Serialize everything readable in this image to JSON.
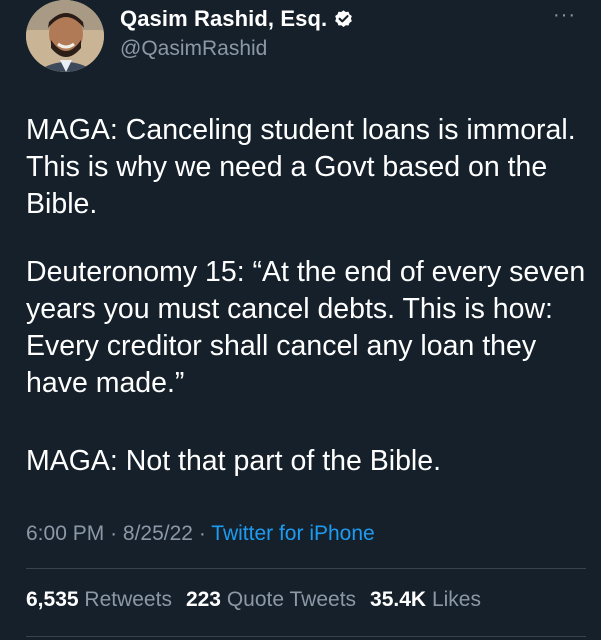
{
  "author": {
    "display_name": "Qasim Rashid, Esq.",
    "handle": "@QasimRashid",
    "verified_icon": "verified-badge-icon",
    "avatar_icon": "profile-photo"
  },
  "menu": {
    "more_label": "···"
  },
  "tweet": {
    "paragraphs": [
      "MAGA: Canceling student loans is immoral. This is why we need a Govt based on the Bible.",
      "Deuteronomy 15: “At the end of every seven years you must cancel debts. This is how: Every creditor shall cancel any loan they have made.”",
      "MAGA: Not that part of the Bible."
    ],
    "time": "6:00 PM",
    "date": "8/25/22",
    "separator": "·",
    "source": "Twitter for iPhone"
  },
  "stats": {
    "retweets_count": "6,535",
    "retweets_label": "Retweets",
    "quotes_count": "223",
    "quotes_label": "Quote Tweets",
    "likes_count": "35.4K",
    "likes_label": "Likes"
  },
  "colors": {
    "background": "#15202b",
    "secondary_text": "#8b98a5",
    "link": "#1d9bf0",
    "verified": "#ffffff",
    "divider": "#38444d"
  }
}
